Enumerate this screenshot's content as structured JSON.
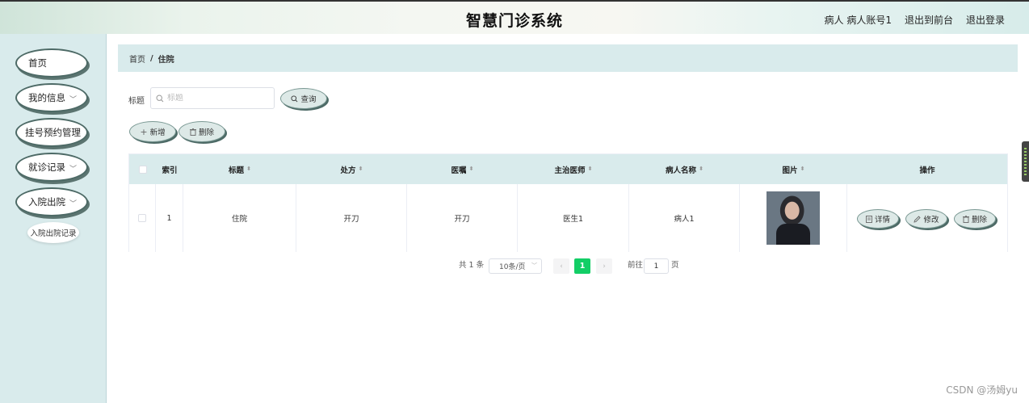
{
  "header": {
    "title": "智慧门诊系统",
    "user": "病人 病人账号1",
    "to_front": "退出到前台",
    "logout": "退出登录"
  },
  "sidebar": {
    "items": [
      {
        "label": "首页",
        "has_children": false
      },
      {
        "label": "我的信息",
        "has_children": true
      },
      {
        "label": "挂号预约管理",
        "has_children": false
      },
      {
        "label": "就诊记录",
        "has_children": true
      },
      {
        "label": "入院出院",
        "has_children": true
      }
    ],
    "sub_item": "入院出院记录"
  },
  "breadcrumb": {
    "home": "首页",
    "separator": "/",
    "current": "住院"
  },
  "search": {
    "label": "标题",
    "placeholder": "标题",
    "button": "查询"
  },
  "actions": {
    "add": "新增",
    "delete": "删除"
  },
  "table": {
    "columns": [
      "索引",
      "标题",
      "处方",
      "医嘱",
      "主治医师",
      "病人名称",
      "图片",
      "操作"
    ],
    "rows": [
      {
        "index": "1",
        "title": "住院",
        "prescription": "开刀",
        "advice": "开刀",
        "doctor": "医生1",
        "patient": "病人1",
        "image": "patient-photo"
      }
    ],
    "row_actions": {
      "detail": "详情",
      "edit": "修改",
      "delete": "删除"
    }
  },
  "pagination": {
    "total": "共 1 条",
    "page_size": "10条/页",
    "current_page": "1",
    "goto_prefix": "前往",
    "goto_value": "1",
    "goto_suffix": "页"
  },
  "watermark": "CSDN @汤姆yu",
  "colors": {
    "accent": "#13ce66",
    "panel": "#d9ebec",
    "outline": "#4d6a66"
  }
}
